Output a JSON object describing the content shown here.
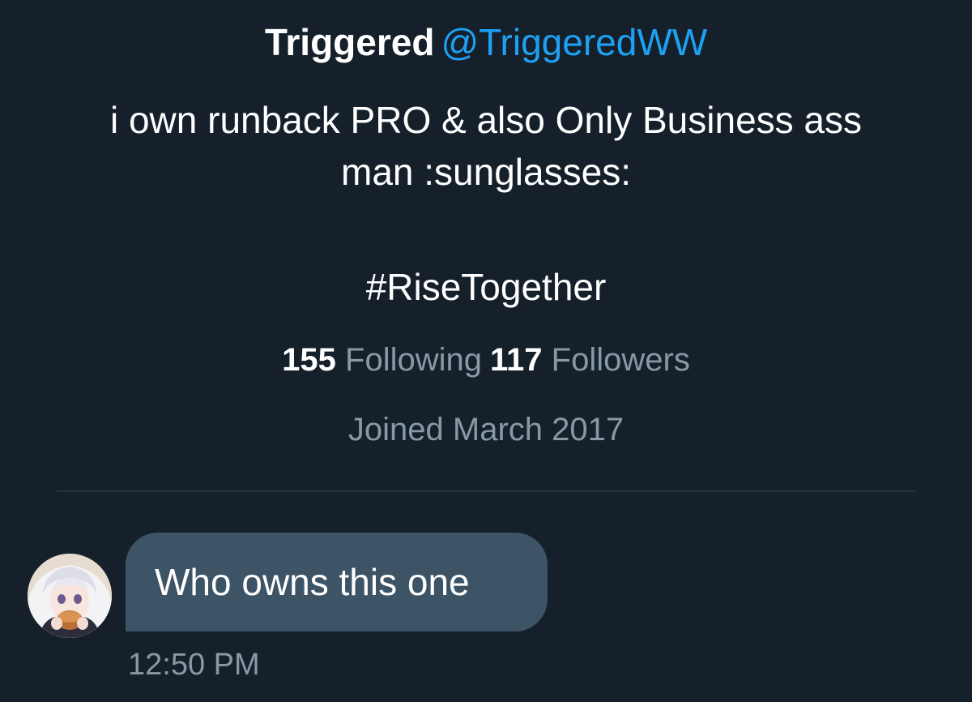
{
  "profile": {
    "name": "Triggered",
    "handle": "@TriggeredWW",
    "bio_lines": [
      "i own runback PRO & also Only Business ass",
      "man :sunglasses:"
    ],
    "hashtag": "#RiseTogether",
    "following_count": "155",
    "following_label": "Following",
    "followers_count": "117",
    "followers_label": "Followers",
    "joined": "Joined March 2017"
  },
  "conversation": {
    "messages": [
      {
        "text": "Who owns this one",
        "time": "12:50 PM"
      }
    ]
  },
  "colors": {
    "background": "#15202b",
    "accent": "#1da1f2",
    "bubble": "#3d5466",
    "secondary_text": "#8899a6"
  },
  "icons": {
    "avatar": "anime-avatar-image"
  }
}
